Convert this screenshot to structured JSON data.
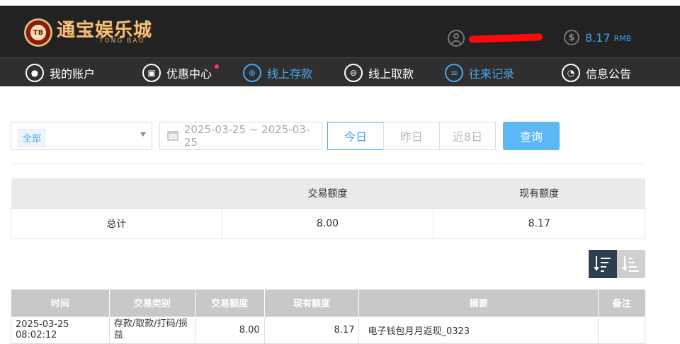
{
  "brand": {
    "chip_text": "TB",
    "name_cn": "通宝娱乐城",
    "name_en": "TONG BAO"
  },
  "account": {
    "balance": "8.17",
    "currency": "RMB"
  },
  "nav": [
    {
      "label": "我的账户",
      "icon": "user-icon",
      "active": false
    },
    {
      "label": "优惠中心",
      "icon": "gift-icon",
      "active": false,
      "badge": true
    },
    {
      "label": "线上存款",
      "icon": "deposit-icon",
      "active": true
    },
    {
      "label": "线上取款",
      "icon": "withdraw-icon",
      "active": false
    },
    {
      "label": "往来记录",
      "icon": "records-icon",
      "active": true
    },
    {
      "label": "信息公告",
      "icon": "bell-icon",
      "active": false
    }
  ],
  "filters": {
    "type_selected": "全部",
    "date_range": "2025-03-25 ~ 2025-03-25",
    "quick": [
      "今日",
      "昨日",
      "近8日"
    ],
    "query_label": "查询"
  },
  "summary": {
    "headers": [
      "",
      "交易额度",
      "现有额度"
    ],
    "row": [
      "总计",
      "8.00",
      "8.17"
    ]
  },
  "detail": {
    "headers": [
      "时间",
      "交易类别",
      "交易额度",
      "现有额度",
      "摘要",
      "备注"
    ],
    "rows": [
      [
        "2025-03-25 08:02:12",
        "存款/取款/打码/损益",
        "8.00",
        "8.17",
        "电子钱包月月返现_0323",
        ""
      ]
    ]
  },
  "colors": {
    "accent": "#49a7ee",
    "header_bg": "#222222",
    "nav_bg": "#2f2f2f",
    "query_btn": "#5cb8f5",
    "sort_active": "#2c3e50"
  }
}
